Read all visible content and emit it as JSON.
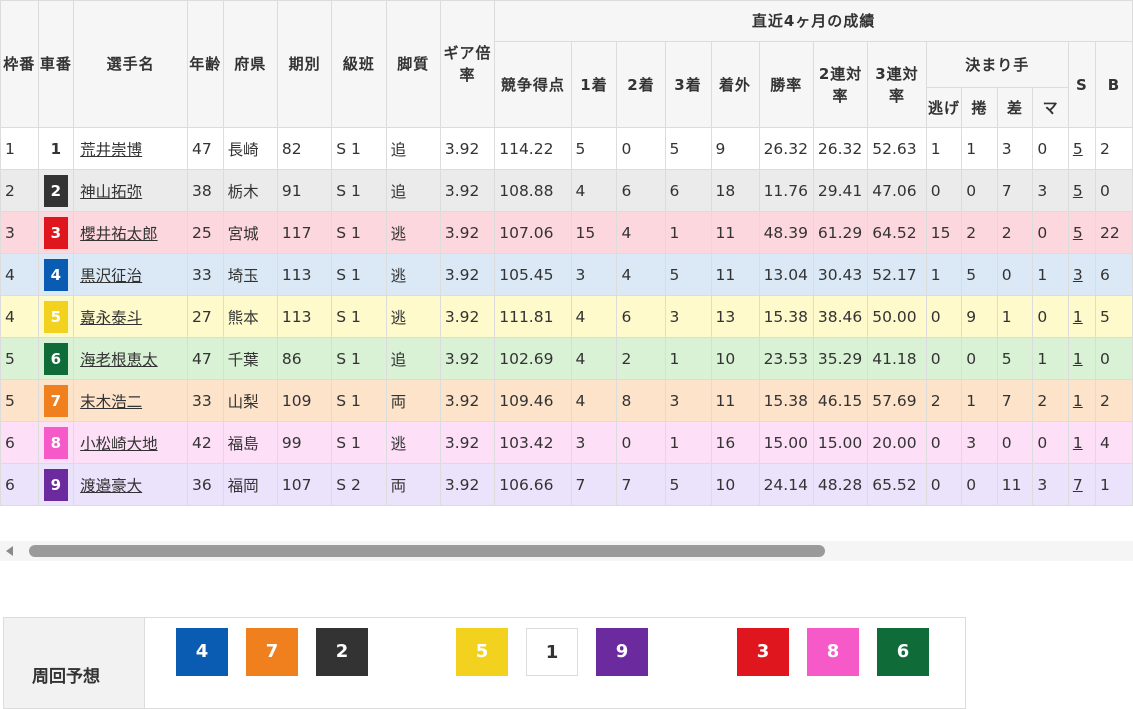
{
  "header": {
    "waku": "枠番",
    "sha": "車番",
    "name": "選手名",
    "age": "年齢",
    "pref": "府県",
    "term": "期別",
    "class": "級班",
    "style": "脚質",
    "gear": "ギア倍率",
    "recent": "直近4ヶ月の成績",
    "score": "競争得点",
    "first": "1着",
    "second": "2着",
    "third": "3着",
    "outside": "着外",
    "win": "勝率",
    "ren2": "2連対率",
    "ren3": "3連対率",
    "kimarite": "決まり手",
    "nige": "逃げ",
    "makuri": "捲",
    "sashi": "差",
    "ma": "マ",
    "s": "S",
    "b": "B"
  },
  "rows": [
    {
      "waku": "1",
      "car": "1",
      "car_bg": "#ffffff",
      "car_fg": "#333333",
      "name": "荒井崇博",
      "age": "47",
      "pref": "長崎",
      "term": "82",
      "class": "S 1",
      "style": "追",
      "gear": "3.92",
      "score": "114.22",
      "first": "5",
      "second": "0",
      "third": "5",
      "outside": "9",
      "win": "26.32",
      "ren2": "26.32",
      "ren3": "52.63",
      "nige": "1",
      "makuri": "1",
      "sashi": "3",
      "ma": "0",
      "s": "5",
      "b": "2"
    },
    {
      "waku": "2",
      "car": "2",
      "car_bg": "#333333",
      "car_fg": "#ffffff",
      "name": "神山拓弥",
      "age": "38",
      "pref": "栃木",
      "term": "91",
      "class": "S 1",
      "style": "追",
      "gear": "3.92",
      "score": "108.88",
      "first": "4",
      "second": "6",
      "third": "6",
      "outside": "18",
      "win": "11.76",
      "ren2": "29.41",
      "ren3": "47.06",
      "nige": "0",
      "makuri": "0",
      "sashi": "7",
      "ma": "3",
      "s": "5",
      "b": "0"
    },
    {
      "waku": "3",
      "car": "3",
      "car_bg": "#e0161e",
      "car_fg": "#ffffff",
      "name": "櫻井祐太郎",
      "age": "25",
      "pref": "宮城",
      "term": "117",
      "class": "S 1",
      "style": "逃",
      "gear": "3.92",
      "score": "107.06",
      "first": "15",
      "second": "4",
      "third": "1",
      "outside": "11",
      "win": "48.39",
      "ren2": "61.29",
      "ren3": "64.52",
      "nige": "15",
      "makuri": "2",
      "sashi": "2",
      "ma": "0",
      "s": "5",
      "b": "22"
    },
    {
      "waku": "4",
      "car": "4",
      "car_bg": "#0a5cb3",
      "car_fg": "#ffffff",
      "name": "黒沢征治",
      "age": "33",
      "pref": "埼玉",
      "term": "113",
      "class": "S 1",
      "style": "逃",
      "gear": "3.92",
      "score": "105.45",
      "first": "3",
      "second": "4",
      "third": "5",
      "outside": "11",
      "win": "13.04",
      "ren2": "30.43",
      "ren3": "52.17",
      "nige": "1",
      "makuri": "5",
      "sashi": "0",
      "ma": "1",
      "s": "3",
      "b": "6"
    },
    {
      "waku": "4",
      "car": "5",
      "car_bg": "#f2d21e",
      "car_fg": "#ffffff",
      "name": "嘉永泰斗",
      "age": "27",
      "pref": "熊本",
      "term": "113",
      "class": "S 1",
      "style": "逃",
      "gear": "3.92",
      "score": "111.81",
      "first": "4",
      "second": "6",
      "third": "3",
      "outside": "13",
      "win": "15.38",
      "ren2": "38.46",
      "ren3": "50.00",
      "nige": "0",
      "makuri": "9",
      "sashi": "1",
      "ma": "0",
      "s": "1",
      "b": "5"
    },
    {
      "waku": "5",
      "car": "6",
      "car_bg": "#0f6b38",
      "car_fg": "#ffffff",
      "name": "海老根恵太",
      "age": "47",
      "pref": "千葉",
      "term": "86",
      "class": "S 1",
      "style": "追",
      "gear": "3.92",
      "score": "102.69",
      "first": "4",
      "second": "2",
      "third": "1",
      "outside": "10",
      "win": "23.53",
      "ren2": "35.29",
      "ren3": "41.18",
      "nige": "0",
      "makuri": "0",
      "sashi": "5",
      "ma": "1",
      "s": "1",
      "b": "0"
    },
    {
      "waku": "5",
      "car": "7",
      "car_bg": "#f07f1e",
      "car_fg": "#ffffff",
      "name": "末木浩二",
      "age": "33",
      "pref": "山梨",
      "term": "109",
      "class": "S 1",
      "style": "両",
      "gear": "3.92",
      "score": "109.46",
      "first": "4",
      "second": "8",
      "third": "3",
      "outside": "11",
      "win": "15.38",
      "ren2": "46.15",
      "ren3": "57.69",
      "nige": "2",
      "makuri": "1",
      "sashi": "7",
      "ma": "2",
      "s": "1",
      "b": "2"
    },
    {
      "waku": "6",
      "car": "8",
      "car_bg": "#f55ac8",
      "car_fg": "#ffffff",
      "name": "小松崎大地",
      "age": "42",
      "pref": "福島",
      "term": "99",
      "class": "S 1",
      "style": "逃",
      "gear": "3.92",
      "score": "103.42",
      "first": "3",
      "second": "0",
      "third": "1",
      "outside": "16",
      "win": "15.00",
      "ren2": "15.00",
      "ren3": "20.00",
      "nige": "0",
      "makuri": "3",
      "sashi": "0",
      "ma": "0",
      "s": "1",
      "b": "4"
    },
    {
      "waku": "6",
      "car": "9",
      "car_bg": "#6b2a9e",
      "car_fg": "#ffffff",
      "name": "渡邉豪大",
      "age": "36",
      "pref": "福岡",
      "term": "107",
      "class": "S 2",
      "style": "両",
      "gear": "3.92",
      "score": "106.66",
      "first": "7",
      "second": "7",
      "third": "5",
      "outside": "10",
      "win": "24.14",
      "ren2": "48.28",
      "ren3": "65.52",
      "nige": "0",
      "makuri": "0",
      "sashi": "11",
      "ma": "3",
      "s": "7",
      "b": "1"
    }
  ],
  "forecast": {
    "label": "周回予想",
    "chips": [
      {
        "num": "4",
        "bg": "#0a5cb3",
        "fg": "#ffffff",
        "border": "none"
      },
      {
        "num": "7",
        "bg": "#f07f1e",
        "fg": "#ffffff",
        "border": "none"
      },
      {
        "num": "2",
        "bg": "#333333",
        "fg": "#ffffff",
        "border": "none"
      },
      {
        "num": "5",
        "bg": "#f2d21e",
        "fg": "#ffffff",
        "border": "none"
      },
      {
        "num": "1",
        "bg": "#ffffff",
        "fg": "#333333",
        "border": "1px solid #dcdcdc"
      },
      {
        "num": "9",
        "bg": "#6b2a9e",
        "fg": "#ffffff",
        "border": "none"
      },
      {
        "num": "3",
        "bg": "#e0161e",
        "fg": "#ffffff",
        "border": "none"
      },
      {
        "num": "8",
        "bg": "#f55ac8",
        "fg": "#ffffff",
        "border": "none"
      },
      {
        "num": "6",
        "bg": "#0f6b38",
        "fg": "#ffffff",
        "border": "none"
      }
    ]
  }
}
